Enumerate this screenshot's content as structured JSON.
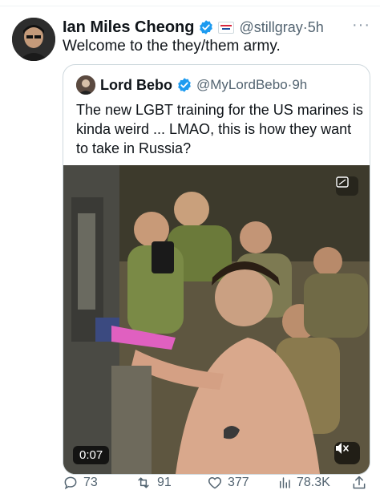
{
  "author": {
    "name": "Ian Miles Cheong",
    "handle": "@stillgray",
    "time": "5h",
    "text": "Welcome to the they/them army."
  },
  "quoted": {
    "name": "Lord Bebo",
    "handle": "@MyLordBebo",
    "time": "9h",
    "text": "The new LGBT training for the US marines is kinda weird ... LMAO, this is how they want to take in Russia?",
    "video_time": "0:07"
  },
  "actions": {
    "replies": "73",
    "reposts": "91",
    "likes": "377",
    "views": "78.3K"
  },
  "colors": {
    "verified": "#1d9bf0",
    "secondary_text": "#536471",
    "border": "#cfd9de"
  },
  "icons": [
    "verified-badge-icon",
    "flag-icon",
    "more-icon",
    "gif-icon",
    "mute-icon",
    "reply-icon",
    "repost-icon",
    "like-icon",
    "views-icon",
    "share-icon"
  ]
}
